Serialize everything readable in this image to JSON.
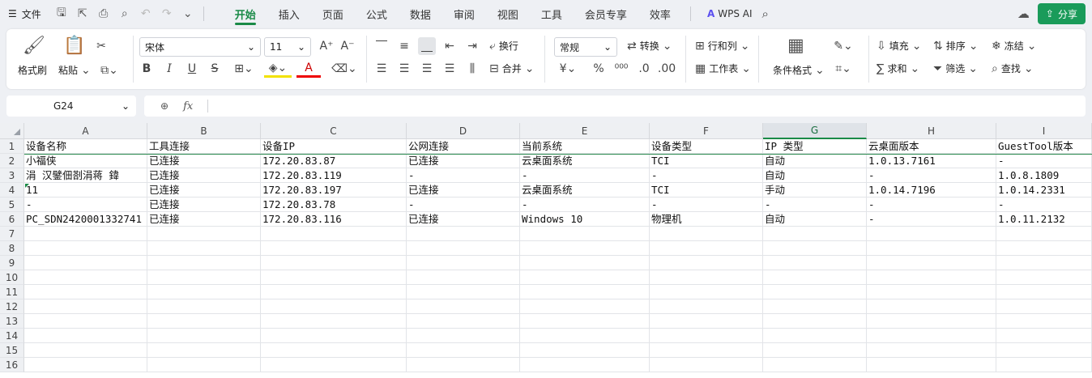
{
  "menubar": {
    "file_label": "文件",
    "tabs": [
      "开始",
      "插入",
      "页面",
      "公式",
      "数据",
      "审阅",
      "视图",
      "工具",
      "会员专享",
      "效率"
    ],
    "active_tab": "开始",
    "wps_ai": "WPS AI",
    "share_label": "分享"
  },
  "ribbon": {
    "format_painter": "格式刷",
    "paste": "粘贴",
    "font_name": "宋体",
    "font_size": "11",
    "wrap": "换行",
    "merge": "合并",
    "number_format": "常规",
    "convert": "转换",
    "row_col": "行和列",
    "worksheet": "工作表",
    "cond_format": "条件格式",
    "fill": "填充",
    "sort": "排序",
    "freeze": "冻结",
    "sum": "求和",
    "filter": "筛选",
    "find": "查找",
    "currency_symbol": "¥",
    "percent_symbol": "%",
    "bold_glyph": "B",
    "italic_glyph": "I",
    "underline_glyph": "U",
    "strike_glyph": "S",
    "font_color_glyph": "A"
  },
  "formula": {
    "cell_ref": "G24",
    "fx": "fx",
    "content": ""
  },
  "sheet": {
    "columns": [
      "A",
      "B",
      "C",
      "D",
      "E",
      "F",
      "G",
      "H",
      "I"
    ],
    "selected_column": "G",
    "row_numbers": [
      "1",
      "2",
      "3",
      "4",
      "5",
      "6",
      "7",
      "8",
      "9",
      "10",
      "11",
      "12",
      "13",
      "14",
      "15",
      "16"
    ],
    "rows": [
      [
        "设备名称",
        "工具连接",
        "设备IP",
        "公网连接",
        "当前系统",
        "设备类型",
        "IP 类型",
        "云桌面版本",
        "GuestTool版本"
      ],
      [
        "小福侠",
        "已连接",
        "172.20.83.87",
        "已连接",
        "云桌面系统",
        "TCI",
        "自动",
        "1.0.13.7161",
        "-"
      ],
      [
        "涓  汉鐾佃剳涓蒋  鍏",
        "已连接",
        "172.20.83.119",
        "-",
        "-",
        "-",
        "自动",
        "-",
        "1.0.8.1809"
      ],
      [
        "11",
        "已连接",
        "172.20.83.197",
        "已连接",
        "云桌面系统",
        "TCI",
        "手动",
        "1.0.14.7196",
        "1.0.14.2331"
      ],
      [
        "-",
        "已连接",
        "172.20.83.78",
        "-",
        "-",
        "-",
        "-",
        "-",
        "-"
      ],
      [
        "PC_SDN2420001332741",
        "已连接",
        "172.20.83.116",
        "已连接",
        "Windows 10",
        "物理机",
        "自动",
        "-",
        "1.0.11.2132"
      ]
    ]
  },
  "colors": {
    "accent": "#1a8a47",
    "share_bg": "#1a9b5a"
  }
}
